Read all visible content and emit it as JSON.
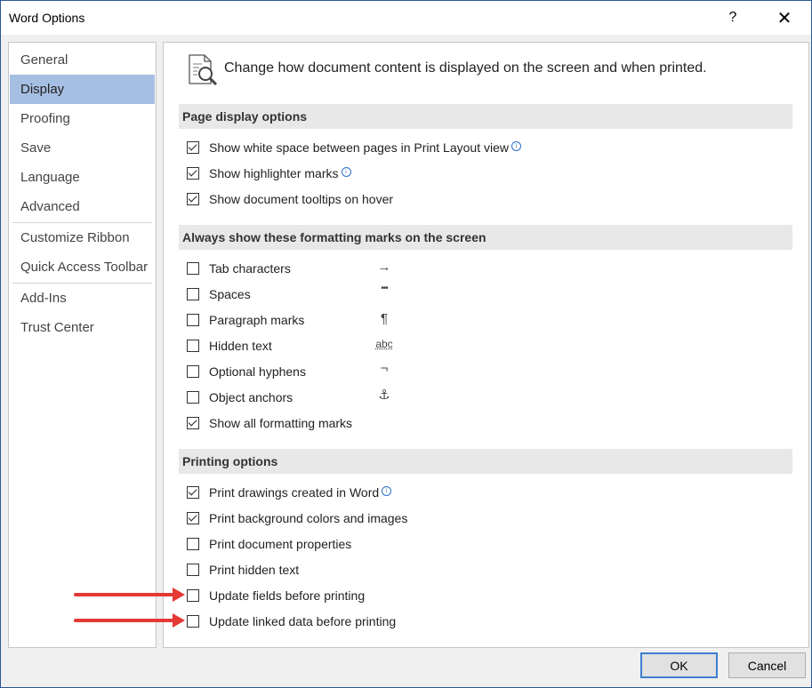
{
  "window": {
    "title": "Word Options",
    "help": "?",
    "close": "✕"
  },
  "sidebar": {
    "items": [
      {
        "label": "General"
      },
      {
        "label": "Display"
      },
      {
        "label": "Proofing"
      },
      {
        "label": "Save"
      },
      {
        "label": "Language"
      },
      {
        "label": "Advanced"
      },
      {
        "label": "Customize Ribbon"
      },
      {
        "label": "Quick Access Toolbar"
      },
      {
        "label": "Add-Ins"
      },
      {
        "label": "Trust Center"
      }
    ],
    "selected": "Display"
  },
  "main": {
    "header": "Change how document content is displayed on the screen and when printed.",
    "page_display": {
      "heading": "Page display options",
      "options": [
        {
          "label": "Show white space between pages in Print Layout view",
          "checked": true,
          "info": "i"
        },
        {
          "label": "Show highlighter marks",
          "checked": true,
          "info": "i"
        },
        {
          "label": "Show document tooltips on hover",
          "checked": true
        }
      ]
    },
    "formatting_marks": {
      "heading": "Always show these formatting marks on the screen",
      "options": [
        {
          "label": "Tab characters",
          "checked": false,
          "mark": "→"
        },
        {
          "label": "Spaces",
          "checked": false,
          "mark": "•••"
        },
        {
          "label": "Paragraph marks",
          "checked": false,
          "mark": "¶"
        },
        {
          "label": "Hidden text",
          "checked": false,
          "mark": "abc"
        },
        {
          "label": "Optional hyphens",
          "checked": false,
          "mark": "¬"
        },
        {
          "label": "Object anchors",
          "checked": false,
          "mark": "⚓"
        },
        {
          "label": "Show all formatting marks",
          "checked": true
        }
      ]
    },
    "printing": {
      "heading": "Printing options",
      "options": [
        {
          "label": "Print drawings created in Word",
          "checked": true,
          "info": "i"
        },
        {
          "label": "Print background colors and images",
          "checked": true
        },
        {
          "label": "Print document properties",
          "checked": false
        },
        {
          "label": "Print hidden text",
          "checked": false
        },
        {
          "label": "Update fields before printing",
          "checked": false
        },
        {
          "label": "Update linked data before printing",
          "checked": false
        }
      ]
    }
  },
  "buttons": {
    "ok": "OK",
    "cancel": "Cancel"
  },
  "colors": {
    "selected_nav": "#a5bfe2",
    "annotation_arrow": "#e53935",
    "ok_border": "#3c7fd1"
  }
}
